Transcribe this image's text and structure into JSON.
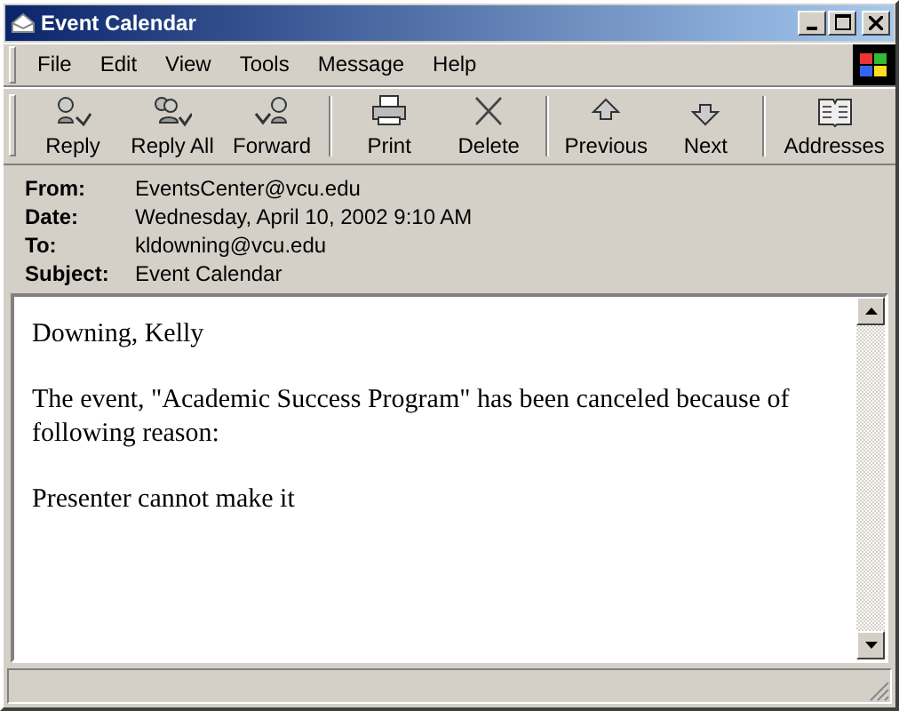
{
  "window": {
    "title": "Event Calendar"
  },
  "menu": [
    "File",
    "Edit",
    "View",
    "Tools",
    "Message",
    "Help"
  ],
  "toolbar": [
    [
      {
        "label": "Reply",
        "kind": "reply"
      },
      {
        "label": "Reply All",
        "kind": "reply_all"
      },
      {
        "label": "Forward",
        "kind": "forward"
      }
    ],
    [
      {
        "label": "Print",
        "kind": "print"
      },
      {
        "label": "Delete",
        "kind": "delete"
      }
    ],
    [
      {
        "label": "Previous",
        "kind": "previous"
      },
      {
        "label": "Next",
        "kind": "next"
      }
    ],
    [
      {
        "label": "Addresses",
        "kind": "addresses"
      }
    ]
  ],
  "headers": [
    {
      "label": "From:",
      "value": "EventsCenter@vcu.edu"
    },
    {
      "label": "Date:",
      "value": "Wednesday, April 10, 2002 9:10 AM"
    },
    {
      "label": "To:",
      "value": "kldowning@vcu.edu"
    },
    {
      "label": "Subject:",
      "value": "Event Calendar"
    }
  ],
  "body": [
    "Downing, Kelly",
    "The event, \"Academic Success Program\" has been canceled because of following reason:",
    "Presenter cannot make it"
  ]
}
